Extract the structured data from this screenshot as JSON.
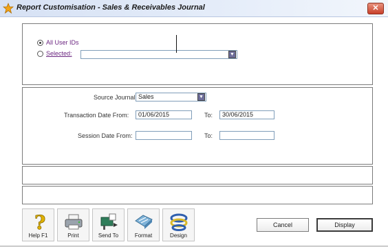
{
  "window": {
    "title": "Report Customisation - Sales & Receivables Journal",
    "close_label": "✕"
  },
  "user_filter": {
    "all_label": "All User IDs",
    "selected_label": "Selected:",
    "selected_value": "",
    "mode": "all"
  },
  "filters": {
    "source_journal_label": "Source Journal:",
    "source_journal_value": "Sales",
    "transaction_date_label": "Transaction Date From:",
    "transaction_date_from": "01/06/2015",
    "transaction_to_label": "To:",
    "transaction_date_to": "30/06/2015",
    "session_date_label": "Session Date From:",
    "session_date_from": "",
    "session_to_label": "To:",
    "session_date_to": ""
  },
  "toolbar": {
    "help_label": "Help F1",
    "print_label": "Print",
    "sendto_label": "Send To",
    "format_label": "Format",
    "design_label": "Design"
  },
  "actions": {
    "cancel_label": "Cancel",
    "display_label": "Display"
  },
  "colors": {
    "accent_purple": "#6b2580",
    "dropdown_button": "#6d6d9a",
    "close_button": "#c9402a"
  }
}
